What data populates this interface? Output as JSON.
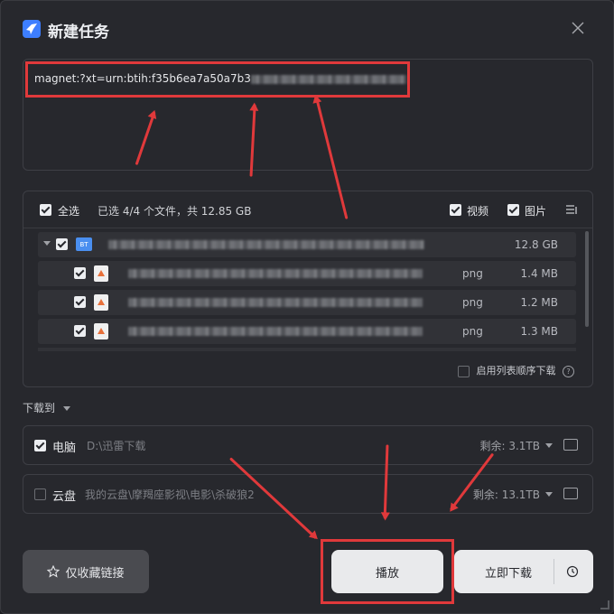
{
  "title": "新建任务",
  "magnet": "magnet:?xt=urn:btih:f35b6ea7a50a7b3",
  "files": {
    "select_all": "全选",
    "summary": "已选 4/4 个文件，共 12.85 GB",
    "filter_video": "视频",
    "filter_image": "图片",
    "folder_size": "12.8 GB",
    "items": [
      {
        "ext": "png",
        "size": "1.4 MB"
      },
      {
        "ext": "png",
        "size": "1.2 MB"
      },
      {
        "ext": "png",
        "size": "1.3 MB"
      }
    ],
    "ordered_download": "启用列表顺序下载",
    "bt_badge": "BT"
  },
  "save_to_label": "下载到",
  "destinations": [
    {
      "name": "电脑",
      "path": "D:\\迅雷下载",
      "remaining": "剩余: 3.1TB",
      "checked": true
    },
    {
      "name": "云盘",
      "path": "我的云盘\\摩羯座影视\\电影\\杀破狼2",
      "remaining": "剩余: 13.1TB",
      "checked": false
    }
  ],
  "buttons": {
    "bookmark": "仅收藏链接",
    "play": "播放",
    "download": "立即下载"
  },
  "colors": {
    "accent": "#3d7eff",
    "highlight": "#e0393b",
    "background": "#27282d"
  }
}
